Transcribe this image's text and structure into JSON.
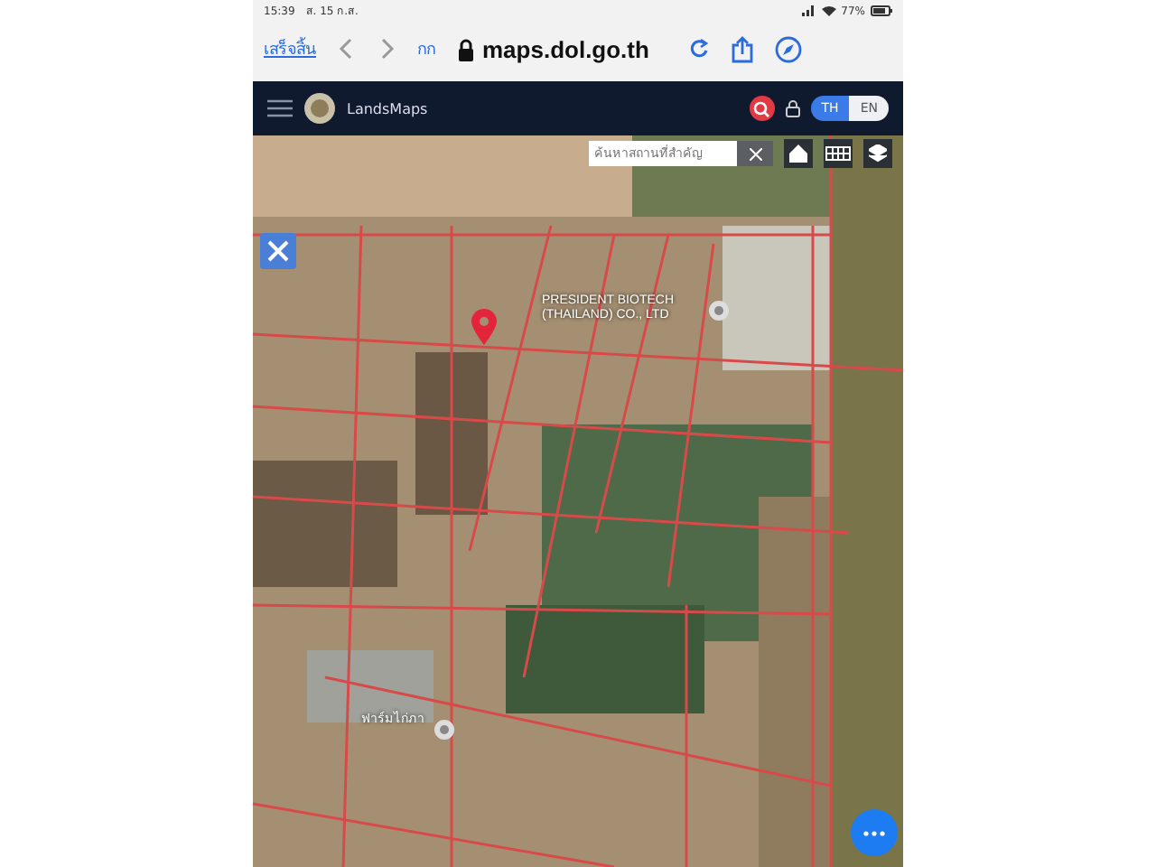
{
  "status_bar": {
    "time": "15:39",
    "date": "ส. 15 ก.ส.",
    "battery": "77%"
  },
  "browser": {
    "done": "เสร็จสิ้น",
    "text_size": "กก",
    "url": "maps.dol.go.th"
  },
  "header": {
    "title": "LandsMaps",
    "languages": [
      {
        "label": "TH",
        "selected": true
      },
      {
        "label": "EN",
        "selected": false
      }
    ]
  },
  "search": {
    "placeholder": "ค้นหาสถานที่สำคัญ"
  },
  "map_labels": [
    {
      "text": "PRESIDENT BIOTECH (THAILAND) CO., LTD",
      "kind": "place"
    },
    {
      "text": "ฟาร์มไก่ภา",
      "kind": "place"
    }
  ]
}
